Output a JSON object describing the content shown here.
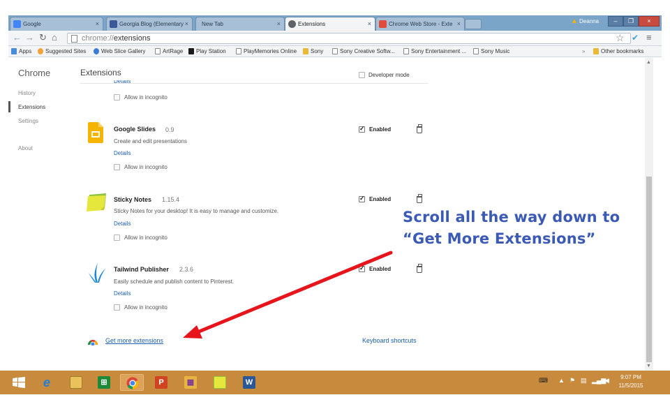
{
  "browser": {
    "tabs": [
      {
        "label": "Google",
        "icon": "google-icon",
        "color": "#4285f4"
      },
      {
        "label": "Georgia Blog (Elementary",
        "icon": "facebook-icon",
        "color": "#3b5998"
      },
      {
        "label": "New Tab",
        "icon": "",
        "color": ""
      },
      {
        "label": "Extensions",
        "icon": "puzzle-icon",
        "color": "#5f6368"
      },
      {
        "label": "Chrome Web Store - Exte",
        "icon": "webstore-icon",
        "color": "#e14b3b"
      }
    ],
    "tab_close": "×",
    "user_name": "Deanna",
    "window_controls": [
      "–",
      "❐",
      "×"
    ],
    "url_prefix": "chrome://",
    "url_path": "extensions"
  },
  "bookmarks": [
    {
      "label": "Apps",
      "color": "#4a8bd8"
    },
    {
      "label": "Suggested Sites",
      "color": "#f2a33a"
    },
    {
      "label": "Web Slice Gallery",
      "color": "#3a7bd5"
    },
    {
      "label": "ArtRage",
      "color": "#ffffff"
    },
    {
      "label": "Play Station",
      "color": "#1b1b1b"
    },
    {
      "label": "PlayMemories Online",
      "color": "#ffffff"
    },
    {
      "label": "Sony",
      "color": "#e8b93a"
    },
    {
      "label": "Sony Creative Softw...",
      "color": "#ffffff"
    },
    {
      "label": "Sony Entertainment ...",
      "color": "#ffffff"
    },
    {
      "label": "Sony Music",
      "color": "#ffffff"
    }
  ],
  "bookmarks_overflow": "»",
  "other_bookmarks": "Other bookmarks",
  "sidebar": {
    "title": "Chrome",
    "items": [
      "History",
      "Extensions",
      "Settings",
      "About"
    ]
  },
  "main": {
    "title": "Extensions",
    "developer_mode": "Developer mode",
    "top_partial": {
      "details": "Details",
      "incognito": "Allow in incognito"
    },
    "extensions": [
      {
        "name": "Google Slides",
        "version": "0.9",
        "description": "Create and edit presentations",
        "details": "Details",
        "incognito": "Allow in incognito",
        "enabled": "Enabled",
        "icon": "google-slides-icon"
      },
      {
        "name": "Sticky Notes",
        "version": "1.15.4",
        "description": "Sticky Notes for your desktop! It is easy to manage and customize.",
        "details": "Details",
        "incognito": "Allow in incognito",
        "enabled": "Enabled",
        "icon": "sticky-notes-icon"
      },
      {
        "name": "Tailwind Publisher",
        "version": "2.3.6",
        "description": "Easily schedule and publish content to Pinterest.",
        "details": "Details",
        "incognito": "Allow in incognito",
        "enabled": "Enabled",
        "icon": "tailwind-icon"
      }
    ],
    "get_more": "Get more extensions",
    "keyboard_shortcuts": "Keyboard shortcuts"
  },
  "annotation": {
    "line1": "Scroll all the way down to",
    "line2": "“Get More Extensions”",
    "color": "#3b59b6",
    "arrow_color": "#e8141c"
  },
  "taskbar": {
    "apps": [
      "windows-start-icon",
      "internet-explorer-icon",
      "file-explorer-icon",
      "store-icon",
      "chrome-icon",
      "powerpoint-icon",
      "app-grid-icon",
      "sticky-notes-icon",
      "word-icon"
    ],
    "clock_time": "9:07 PM",
    "clock_date": "11/5/2015",
    "color": "#c88a3c"
  }
}
